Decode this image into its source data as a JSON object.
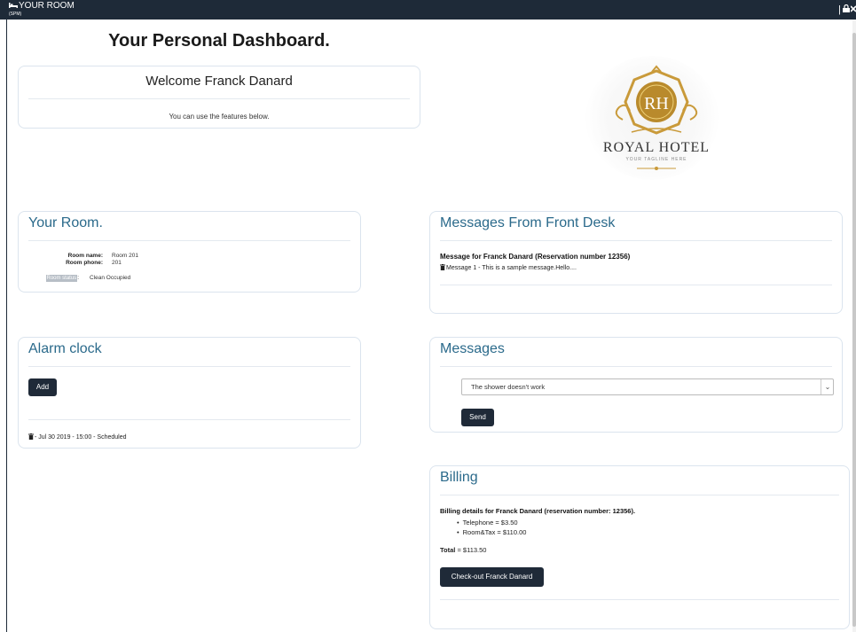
{
  "app": {
    "name": "YOUR ROOM",
    "sub": "(SPM)"
  },
  "page_title": "Your Personal Dashboard.",
  "welcome": {
    "title": "Welcome Franck Danard",
    "subtitle": "You can use the features below."
  },
  "logo": {
    "title": "ROYAL HOTEL",
    "tagline": "YOUR TAGLINE HERE",
    "monogram": "RH"
  },
  "room": {
    "title": "Your Room.",
    "name_label": "Room name:",
    "name_value": "Room 201",
    "phone_label": "Room phone:",
    "phone_value": "201",
    "status_label": "Room status",
    "status_suffix": ":",
    "status_value": "Clean Occupied"
  },
  "front_desk": {
    "title": "Messages From Front Desk",
    "heading": "Message for Franck Danard (Reservation number 12356)",
    "message": "Message 1 - This is a sample message.Hello...."
  },
  "alarm": {
    "title": "Alarm  clock",
    "add_label": "Add",
    "entry": "- Jul 30 2019 - 15:00 - Scheduled"
  },
  "messages": {
    "title": "Messages",
    "selected": "The shower doesn't work",
    "send_label": "Send"
  },
  "billing": {
    "title": "Billing",
    "details": "Billing details for Franck Danard (reservation number: 12356).",
    "items": [
      "Telephone = $3.50",
      "Room&Tax = $110.00"
    ],
    "total_label": "Total",
    "total_value": " = $113.50",
    "checkout_label": "Check-out Franck Danard"
  },
  "colors": {
    "header_bg": "#1e2a38",
    "card_title": "#2b6a8b",
    "button_bg": "#1f2a38",
    "gold": "#c99a3a"
  }
}
